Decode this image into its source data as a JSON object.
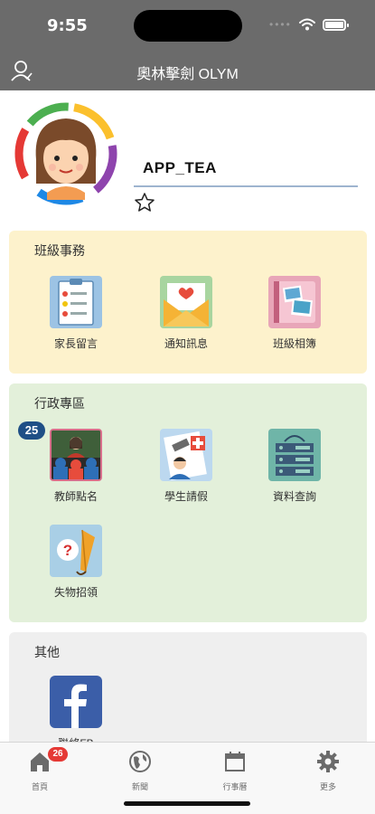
{
  "status_bar": {
    "time": "9:55",
    "signal": "••••"
  },
  "nav": {
    "title": "奧林擊劍 OLYM"
  },
  "profile": {
    "username": "APP_TEA"
  },
  "sections": {
    "class_affairs": {
      "title": "班級事務",
      "items": [
        {
          "label": "家長留言",
          "icon": "parent-message-icon"
        },
        {
          "label": "通知訊息",
          "icon": "envelope-icon"
        },
        {
          "label": "班級相簿",
          "icon": "photo-album-icon"
        }
      ]
    },
    "admin": {
      "title": "行政專區",
      "roll_call_badge": "25",
      "items": [
        {
          "label": "教師點名",
          "icon": "teacher-rollcall-icon"
        },
        {
          "label": "學生請假",
          "icon": "student-leave-icon"
        },
        {
          "label": "資料查詢",
          "icon": "server-icon"
        },
        {
          "label": "失物招領",
          "icon": "lost-found-icon"
        }
      ]
    },
    "other": {
      "title": "其他",
      "items": [
        {
          "label": "聯絡FB",
          "icon": "facebook-icon"
        }
      ]
    }
  },
  "tabbar": {
    "home_badge": "26",
    "tabs": [
      {
        "label": "首頁",
        "icon": "home-icon"
      },
      {
        "label": "新聞",
        "icon": "globe-icon"
      },
      {
        "label": "行事曆",
        "icon": "calendar-icon"
      },
      {
        "label": "更多",
        "icon": "gear-icon"
      }
    ]
  },
  "colors": {
    "nav_bg": "#6b6b6b",
    "class_section_bg": "#fdf2cc",
    "admin_section_bg": "#e3f0da",
    "other_section_bg": "#efefef",
    "badge_blue": "#1f4f86",
    "badge_red": "#e53935"
  }
}
